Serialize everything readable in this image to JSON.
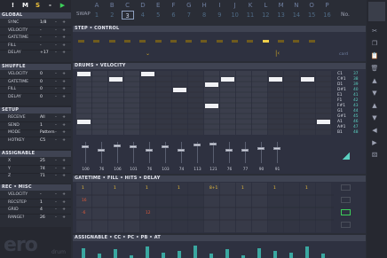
{
  "toolbar": {
    "buttons": [
      {
        "label": "!",
        "color": "#ffffff"
      },
      {
        "label": "M",
        "color": "#ffffff"
      },
      {
        "label": "S",
        "color": "#f0c33a"
      },
      {
        "label": "-",
        "color": "#ffffff"
      },
      {
        "label": "▶",
        "color": "#3ccf5a"
      }
    ]
  },
  "pattern_letters": [
    "A",
    "B",
    "C",
    "D",
    "E",
    "F",
    "G",
    "H",
    "I",
    "J",
    "K",
    "L",
    "M",
    "N",
    "O",
    "P"
  ],
  "swap_label": "SWAP",
  "step_numbers": [
    "1",
    "2",
    "3",
    "4",
    "5",
    "6",
    "7",
    "8",
    "9",
    "10",
    "11",
    "12",
    "13",
    "14",
    "15",
    "16"
  ],
  "no_label": "No.",
  "global": {
    "title": "GLOBAL",
    "rows": [
      {
        "label": "SYNC",
        "value": "1/8",
        "b1": "-",
        "b2": "+"
      },
      {
        "label": "VELOCITY",
        "value": "-",
        "b1": "-",
        "b2": "+"
      },
      {
        "label": "GATETIME",
        "value": "-",
        "b1": "-",
        "b2": "+"
      },
      {
        "label": "FILL",
        "value": "-",
        "b1": "-",
        "b2": "+"
      },
      {
        "label": "DELAY",
        "value": "+17",
        "b1": "-",
        "b2": "+"
      }
    ]
  },
  "shuffle": {
    "title": "SHUFFLE",
    "rows": [
      {
        "label": "VELOCITY",
        "value": "0",
        "b1": "-",
        "b2": "+"
      },
      {
        "label": "GATETIME",
        "value": "0",
        "b1": "-",
        "b2": "+"
      },
      {
        "label": "FILL",
        "value": "0",
        "b1": "-",
        "b2": "+"
      },
      {
        "label": "DELAY",
        "value": "0",
        "b1": "-",
        "b2": "+"
      }
    ]
  },
  "setup": {
    "title": "SETUP",
    "rows": [
      {
        "label": "RECEIVE",
        "value": "All",
        "b1": "-",
        "b2": "+"
      },
      {
        "label": "SEND",
        "value": "1",
        "b1": "-",
        "b2": "+"
      },
      {
        "label": "MODE",
        "value": "Pattern",
        "b1": "-",
        "b2": "+"
      },
      {
        "label": "HOTKEY",
        "value": "C5",
        "b1": "-",
        "b2": "+"
      }
    ]
  },
  "assignable": {
    "title": "ASSIGNABLE",
    "rows": [
      {
        "label": "X",
        "value": "25",
        "b1": "-",
        "b2": "+"
      },
      {
        "label": "Y",
        "value": "74",
        "b1": "-",
        "b2": "+"
      },
      {
        "label": "Z",
        "value": "71",
        "b1": "-",
        "b2": "+"
      }
    ]
  },
  "rec_misc": {
    "title": "REC • MISC",
    "rows": [
      {
        "label": "VELOCITY",
        "value": "-",
        "b1": "-",
        "b2": "+"
      },
      {
        "label": "RECSTEP",
        "value": "1",
        "b1": "-",
        "b2": "+"
      },
      {
        "label": "GRID",
        "value": "4",
        "b1": "-",
        "b2": "+"
      },
      {
        "label": "RANGE?",
        "value": "26",
        "b1": "-",
        "b2": "+"
      }
    ]
  },
  "logo": "ero",
  "logo_sub": "drum",
  "step_control": {
    "title": "STEP • CONTROL",
    "active_step": 13,
    "ctrl_label": "card"
  },
  "drums": {
    "title": "DRUMS • VELOCITY",
    "notes": [
      "C1",
      "C#1",
      "D1",
      "D#1",
      "E1",
      "F1",
      "F#1",
      "G1",
      "G#1",
      "A1",
      "A#1",
      "B1"
    ],
    "note_values": [
      "37",
      "38",
      "39",
      "40",
      "41",
      "42",
      "43",
      "44",
      "45",
      "46",
      "47",
      "48"
    ],
    "velocities": [
      "100",
      "76",
      "106",
      "101",
      "76",
      "103",
      "74",
      "113",
      "121",
      "76",
      "77",
      "90",
      "91"
    ]
  },
  "gatetime": {
    "title": "GATETIME • FILL • HITS • DELAY",
    "markers": [
      {
        "text": "1",
        "color": "#f0c33a"
      },
      {
        "text": "1",
        "color": "#f0c33a"
      },
      {
        "text": "1",
        "color": "#f0c33a"
      },
      {
        "text": "1",
        "color": "#f0c33a"
      },
      {
        "text": "8+1",
        "color": "#f0c33a"
      },
      {
        "text": "1",
        "color": "#f0c33a"
      },
      {
        "text": "1",
        "color": "#f0c33a"
      },
      {
        "text": "1",
        "color": "#f0c33a"
      },
      {
        "text": "16",
        "color": "#e05a3a"
      },
      {
        "text": "-6",
        "color": "#e05a3a"
      },
      {
        "text": "12",
        "color": "#e05a3a"
      }
    ]
  },
  "assign_cc": {
    "title": "ASSIGNABLE • CC • PC • PB • AT"
  },
  "right_icons": [
    "scissors-icon",
    "copy-icon",
    "paste-icon",
    "trash-icon",
    "up-icon",
    "down-icon",
    "up-icon",
    "down-icon",
    "left-icon",
    "right-icon",
    "random-icon"
  ],
  "colors": {
    "accent": "#3ccf5a",
    "yellow": "#f0c33a",
    "cyan": "#5bd0c0",
    "teal": "#3aa7a0"
  }
}
